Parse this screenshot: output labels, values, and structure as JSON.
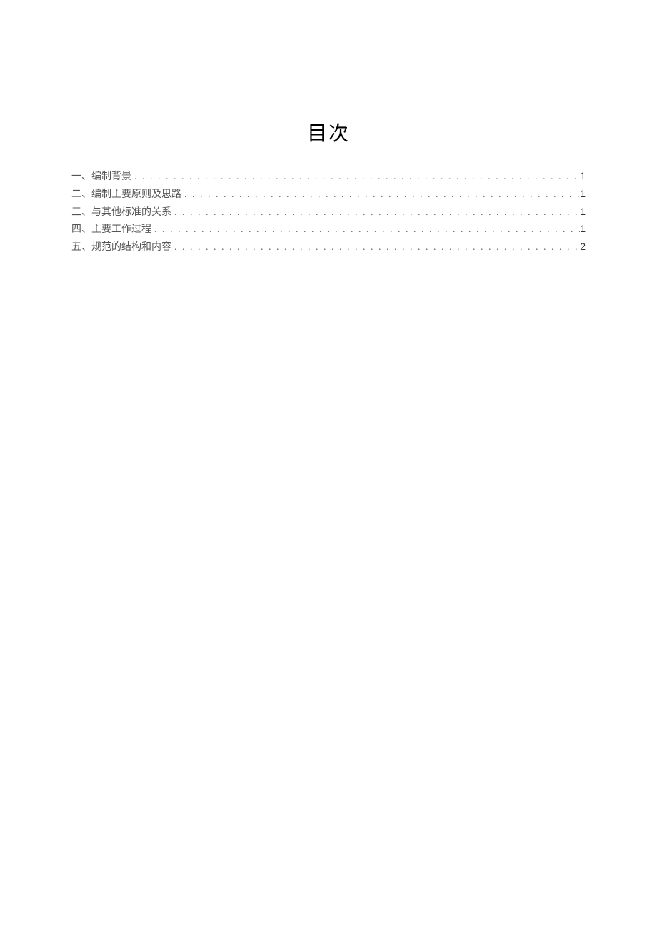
{
  "title": "目次",
  "toc": {
    "entries": [
      {
        "label": "一、编制背景",
        "page": "1"
      },
      {
        "label": "二、编制主要原则及思路",
        "page": "1"
      },
      {
        "label": "三、与其他标准的关系",
        "page": "1"
      },
      {
        "label": "四、主要工作过程",
        "page": "1"
      },
      {
        "label": "五、规范的结构和内容",
        "page": "2"
      }
    ]
  }
}
